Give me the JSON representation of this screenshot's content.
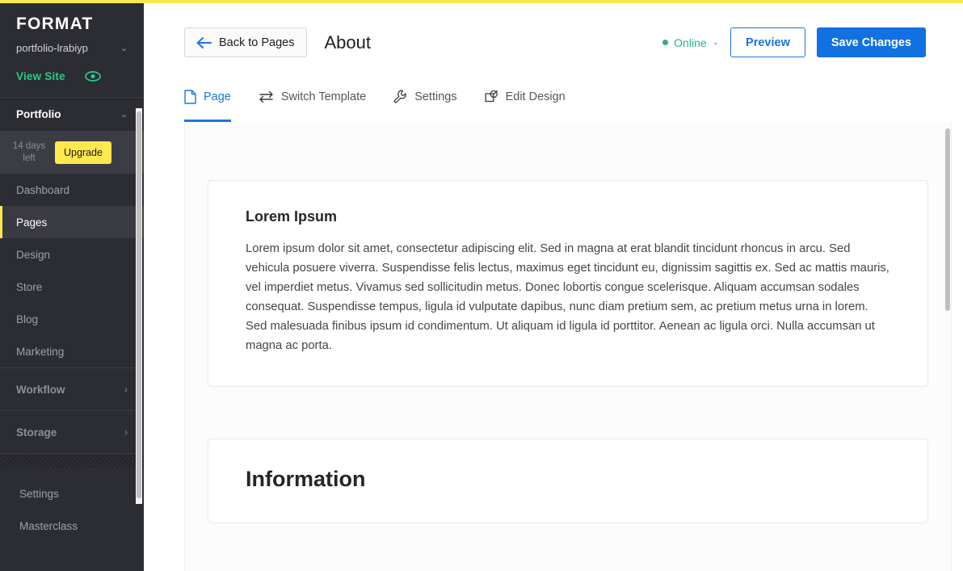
{
  "brand": {
    "logo": "FORMAT",
    "site_name": "portfolio-lrabiyp",
    "site_chevron": "⌄",
    "view_site_label": "View Site",
    "accent_yellow": "#f7e84f",
    "accent_green": "#28c98c"
  },
  "sidebar": {
    "portfolio_header": "Portfolio",
    "portfolio_chevron": "⌄",
    "trial": {
      "days_label": "14 days left",
      "upgrade_label": "Upgrade"
    },
    "nav_items": [
      {
        "label": "Dashboard",
        "active": false
      },
      {
        "label": "Pages",
        "active": true
      },
      {
        "label": "Design",
        "active": false
      },
      {
        "label": "Store",
        "active": false
      },
      {
        "label": "Blog",
        "active": false
      },
      {
        "label": "Marketing",
        "active": false
      }
    ],
    "groups": [
      {
        "label": "Workflow",
        "arrow": "›"
      },
      {
        "label": "Storage",
        "arrow": "›"
      }
    ],
    "bottom_items": [
      {
        "label": "Settings"
      },
      {
        "label": "Masterclass"
      }
    ]
  },
  "header": {
    "back_label": "Back to Pages",
    "page_title": "About",
    "status_label": "Online",
    "status_chevron": "⌄",
    "preview_label": "Preview",
    "save_label": "Save Changes",
    "primary_blue": "#1171e0",
    "status_green": "#26b37a"
  },
  "tabs": [
    {
      "label": "Page",
      "icon": "document-icon",
      "active": true
    },
    {
      "label": "Switch Template",
      "icon": "swap-arrows-icon",
      "active": false
    },
    {
      "label": "Settings",
      "icon": "wrench-icon",
      "active": false
    },
    {
      "label": "Edit Design",
      "icon": "design-stamp-icon",
      "active": false
    }
  ],
  "content": {
    "cards": [
      {
        "title": "Lorem Ipsum",
        "body": "Lorem ipsum dolor sit amet, consectetur adipiscing elit. Sed in magna at erat blandit tincidunt rhoncus in arcu. Sed vehicula posuere viverra. Suspendisse felis lectus, maximus eget tincidunt eu, dignissim sagittis ex. Sed ac mattis mauris, vel imperdiet metus. Vivamus sed sollicitudin metus. Donec lobortis congue scelerisque. Aliquam accumsan sodales consequat. Suspendisse tempus, ligula id vulputate dapibus, nunc diam pretium sem, ac pretium metus urna in lorem. Sed malesuada finibus ipsum id condimentum. Ut aliquam id ligula id porttitor. Aenean ac ligula orci. Nulla accumsan ut magna ac porta."
      },
      {
        "title": "Information",
        "body": ""
      }
    ]
  }
}
